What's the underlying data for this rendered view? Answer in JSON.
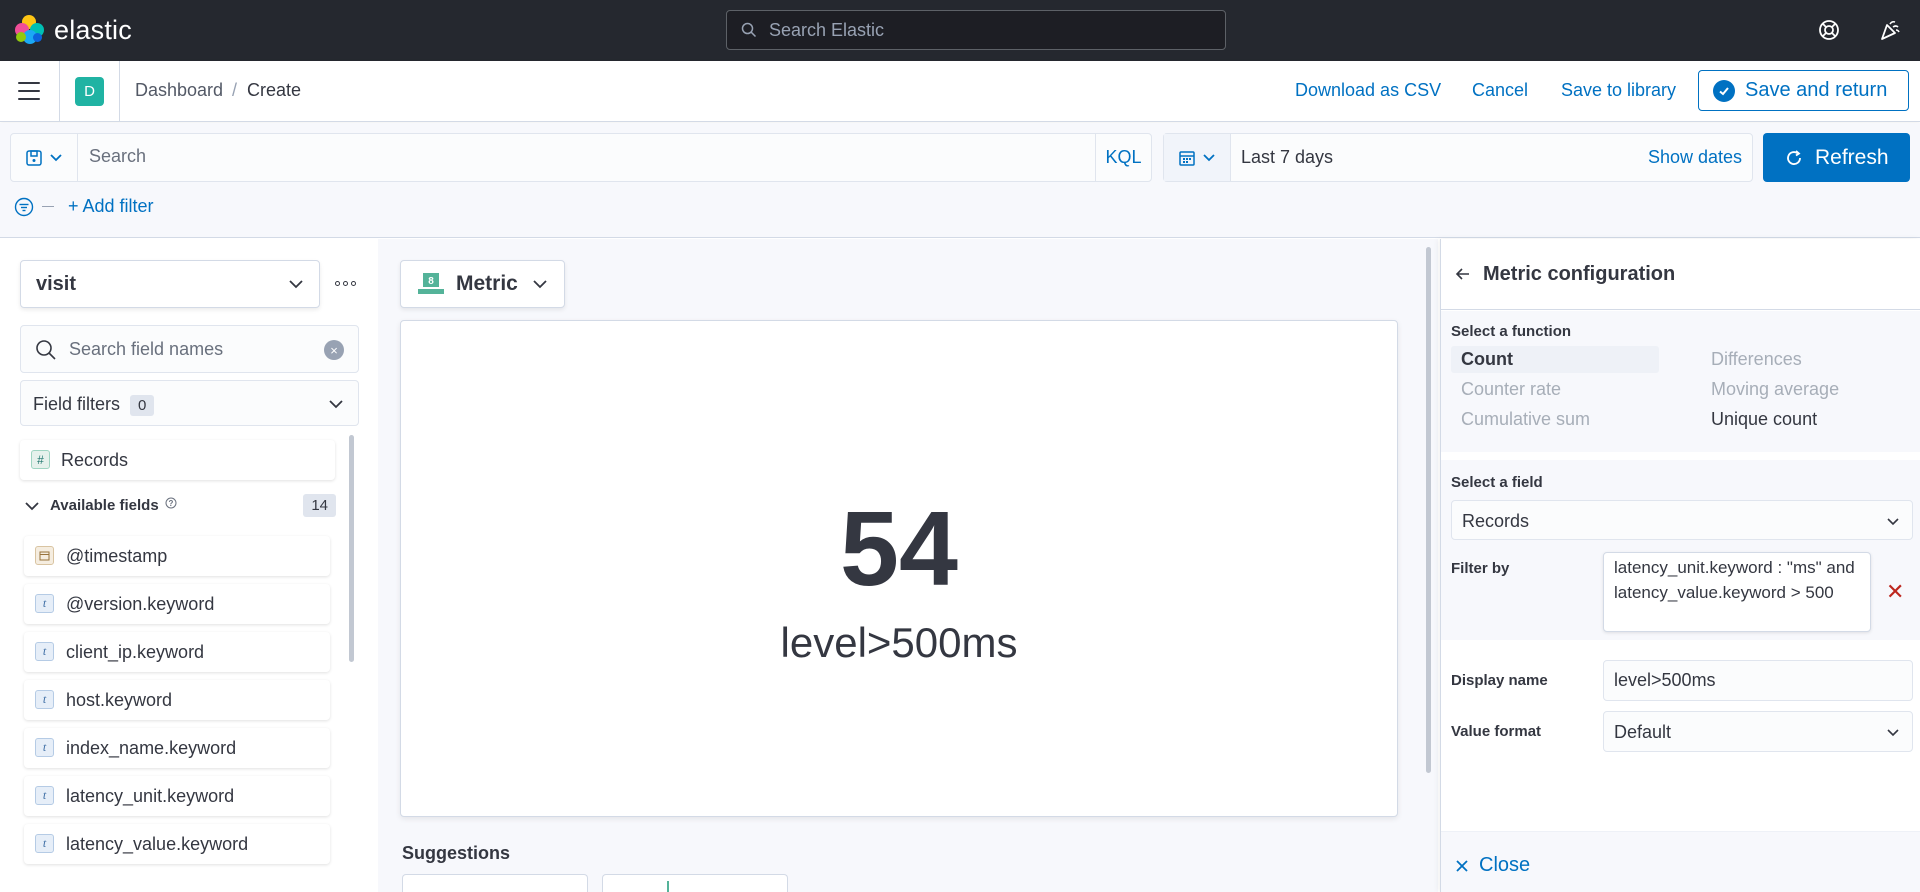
{
  "header": {
    "logo_text": "elastic",
    "search_placeholder": "Search Elastic"
  },
  "breadcrumb": {
    "space_initial": "D",
    "items": [
      "Dashboard",
      "Create"
    ]
  },
  "actions": {
    "download_csv": "Download as CSV",
    "cancel": "Cancel",
    "save_to_library": "Save to library",
    "save_and_return": "Save and return"
  },
  "query": {
    "search_placeholder": "Search",
    "language": "KQL",
    "date_range": "Last 7 days",
    "show_dates": "Show dates",
    "refresh": "Refresh",
    "add_filter": "+ Add filter"
  },
  "left_panel": {
    "index_pattern": "visit",
    "field_search_placeholder": "Search field names",
    "field_filters_label": "Field filters",
    "field_filters_count": "0",
    "records_label": "Records",
    "available_fields_label": "Available fields",
    "available_fields_count": "14",
    "fields": [
      {
        "name": "@timestamp",
        "type": "date"
      },
      {
        "name": "@version.keyword",
        "type": "text"
      },
      {
        "name": "client_ip.keyword",
        "type": "text"
      },
      {
        "name": "host.keyword",
        "type": "text"
      },
      {
        "name": "index_name.keyword",
        "type": "text"
      },
      {
        "name": "latency_unit.keyword",
        "type": "text"
      },
      {
        "name": "latency_value.keyword",
        "type": "text"
      }
    ]
  },
  "workspace": {
    "chart_type": "Metric",
    "metric_value": "54",
    "metric_label": "level>500ms",
    "suggestions_label": "Suggestions"
  },
  "config_panel": {
    "title": "Metric configuration",
    "select_function_label": "Select a function",
    "functions": {
      "count": "Count",
      "differences": "Differences",
      "counter_rate": "Counter rate",
      "moving_average": "Moving average",
      "cumulative_sum": "Cumulative sum",
      "unique_count": "Unique count"
    },
    "select_field_label": "Select a field",
    "selected_field": "Records",
    "filter_by_label": "Filter by",
    "filter_query": "latency_unit.keyword : \"ms\" and latency_value.keyword > 500",
    "display_name_label": "Display name",
    "display_name": "level>500ms",
    "value_format_label": "Value format",
    "value_format": "Default",
    "close": "Close"
  },
  "colors": {
    "header_bg": "#25282f",
    "primary": "#0071c2",
    "space_avatar": "#20b3a3",
    "danger": "#bd271e"
  }
}
